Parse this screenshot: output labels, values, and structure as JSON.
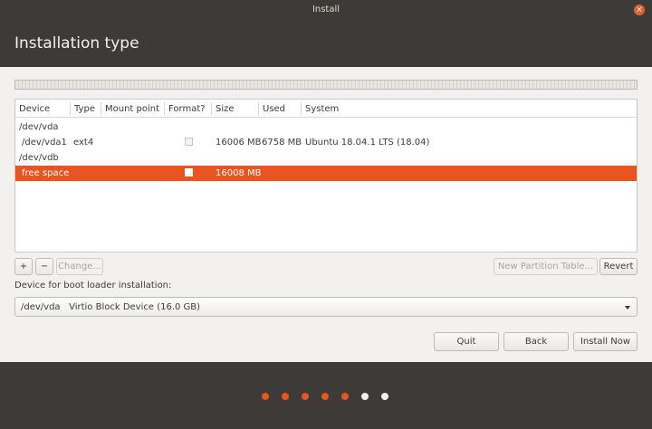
{
  "window": {
    "title": "Install"
  },
  "header": {
    "title": "Installation type"
  },
  "table": {
    "columns": [
      "Device",
      "Type",
      "Mount point",
      "Format?",
      "Size",
      "Used",
      "System"
    ],
    "rows": [
      {
        "device": "/dev/vda",
        "type": "",
        "mount": "",
        "format": null,
        "size": "",
        "used": "",
        "system": ""
      },
      {
        "device": "/dev/vda1",
        "type": "ext4",
        "mount": "",
        "format": false,
        "size": "16006 MB",
        "used": "6758 MB",
        "system": "Ubuntu 18.04.1 LTS (18.04)"
      },
      {
        "device": "/dev/vdb",
        "type": "",
        "mount": "",
        "format": null,
        "size": "",
        "used": "",
        "system": ""
      },
      {
        "device": "free space",
        "type": "",
        "mount": "",
        "format": false,
        "size": "16008 MB",
        "used": "",
        "system": "",
        "selected": true
      }
    ]
  },
  "toolbar": {
    "add_label": "+",
    "remove_label": "−",
    "change_label": "Change...",
    "new_table_label": "New Partition Table...",
    "revert_label": "Revert"
  },
  "bootloader": {
    "label": "Device for boot loader installation:",
    "selected": "/dev/vda   Virtio Block Device (16.0 GB)"
  },
  "actions": {
    "quit_label": "Quit",
    "back_label": "Back",
    "install_label": "Install Now"
  },
  "progress": {
    "total_steps": 7,
    "completed_steps": 5
  },
  "colors": {
    "accent": "#e95420",
    "dot_inactive": "#f2f1f0",
    "chrome": "#3c3b37"
  }
}
